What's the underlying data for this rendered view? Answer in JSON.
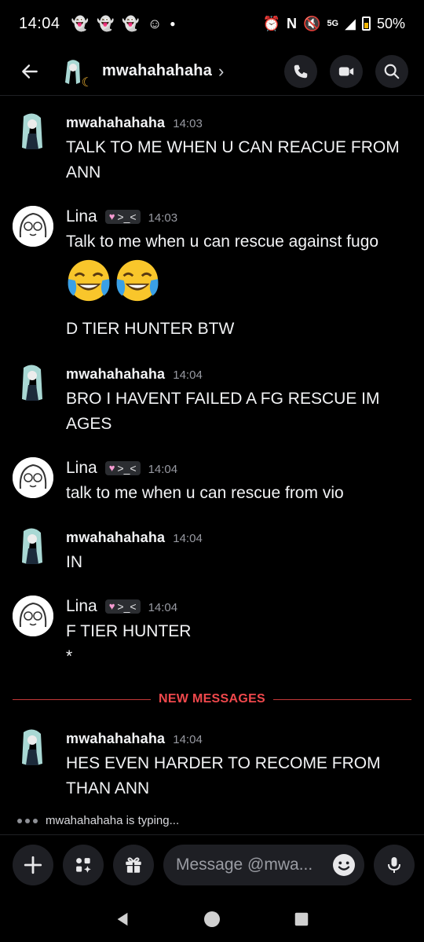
{
  "status": {
    "time": "14:04",
    "battery": "50%",
    "network": "5G"
  },
  "header": {
    "name": "mwahahahaha",
    "chevron": "›"
  },
  "messages": [
    {
      "user": "mwahahahaha",
      "time": "14:03",
      "text": "TALK TO ME WHEN U CAN REACUE FROM ANN"
    },
    {
      "user": "Lina",
      "tag": ">_<",
      "time": "14:03",
      "text": "Talk to me when u can rescue against fugo",
      "emojis": [
        "joy",
        "joy"
      ],
      "text2": "D TIER HUNTER BTW"
    },
    {
      "user": "mwahahahaha",
      "time": "14:04",
      "text": "BRO I HAVENT FAILED A FG RESCUE IM AGES"
    },
    {
      "user": "Lina",
      "tag": ">_<",
      "time": "14:04",
      "text": "talk to me when u can rescue from vio"
    },
    {
      "user": "mwahahahaha",
      "time": "14:04",
      "text": "IN"
    },
    {
      "user": "Lina",
      "tag": ">_<",
      "time": "14:04",
      "text": "F TIER HUNTER",
      "text2": "*"
    },
    {
      "user": "mwahahahaha",
      "time": "14:04",
      "text": "HES EVEN HARDER TO RECOME FROM THAN ANN"
    }
  ],
  "divider": {
    "label": "NEW MESSAGES",
    "color": "#f0484c"
  },
  "typing": {
    "text": "mwahahahaha is typing..."
  },
  "composer": {
    "placeholder": "Message @mwa..."
  },
  "icons": {
    "back": "arrow-left-icon",
    "call": "phone-icon",
    "video": "video-camera-icon",
    "search": "search-icon",
    "add": "plus-icon",
    "apps": "apps-icon",
    "gift": "gift-icon",
    "emoji": "emoji-icon",
    "mic": "microphone-icon"
  }
}
